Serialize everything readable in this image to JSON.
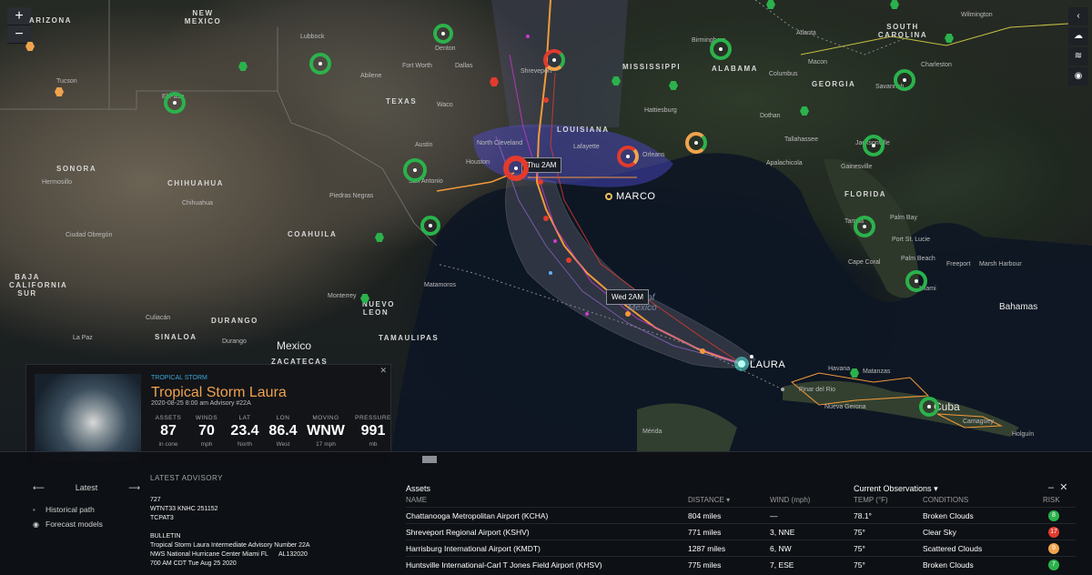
{
  "map": {
    "controls": {
      "zoom_in": "+",
      "zoom_out": "−"
    },
    "right_tools": [
      "chevron-left-icon",
      "cloud-icon",
      "layers-icon",
      "location-icon"
    ],
    "state_labels": [
      {
        "text": "ARIZONA"
      },
      {
        "text": "NEW MEXICO"
      },
      {
        "text": "TEXAS"
      },
      {
        "text": "LOUISIANA"
      },
      {
        "text": "MISSISSIPPI"
      },
      {
        "text": "ALABAMA"
      },
      {
        "text": "GEORGIA"
      },
      {
        "text": "SOUTH CAROLINA"
      },
      {
        "text": "FLORIDA"
      },
      {
        "text": "SONORA"
      },
      {
        "text": "CHIHUAHUA"
      },
      {
        "text": "COAHUILA"
      },
      {
        "text": "BAJA CALIFORNIA SUR"
      },
      {
        "text": "DURANGO"
      },
      {
        "text": "SINALOA"
      },
      {
        "text": "TAMAULIPAS"
      },
      {
        "text": "NUEVO LEON"
      },
      {
        "text": "ZACATECAS"
      }
    ],
    "city_labels": [
      "Lubbock",
      "Denton",
      "Fort Worth",
      "Dallas",
      "Abilene",
      "Waco",
      "Austin",
      "San Antonio",
      "Houston",
      "North Cleveland",
      "Lafayette",
      "Orleans",
      "Shreveport",
      "Birmingham",
      "Atlanta",
      "Macon",
      "Columbus",
      "Savannah",
      "Charleston",
      "Wilmington",
      "Hattiesburg",
      "Dothan",
      "Tallahassee",
      "Jacksonville",
      "Gainesville",
      "Apalachicola",
      "Tampa",
      "Palm Bay",
      "Port St. Lucie",
      "Palm Beach",
      "Freeport",
      "Marsh Harbour",
      "Cape Coral",
      "Miami",
      "Havana",
      "Matanzas",
      "Pinar del Rio",
      "Nueva Gerona",
      "Camagüey",
      "Holguín",
      "Mérida",
      "Hermosillo",
      "Ciudad Obregón",
      "Culiacán",
      "La Paz",
      "Durango",
      "Chihuahua",
      "Piedras Negras",
      "Monterrey",
      "Matamoros",
      "Tucson",
      "El Paso"
    ],
    "big_labels": {
      "mexico": "Mexico",
      "bahamas": "Bahamas",
      "cuba": "Cuba",
      "gulf": "Gulf of Mexico"
    },
    "tooltips": {
      "thu": "Thu 2AM",
      "wed": "Wed 2AM"
    },
    "storms": {
      "laura": "LAURA",
      "marco": "MARCO"
    },
    "colors": {
      "low_risk": "#2bb24c",
      "mid_risk": "#f0a34e",
      "high_risk": "#e23b2e",
      "forecast_track": "#f29a3a",
      "cone": "#5e5ae0"
    }
  },
  "storm_card": {
    "type": "TROPICAL STORM",
    "name": "Tropical Storm Laura",
    "date": "2020-08-25 8:00 am Advisory #22A",
    "stats": [
      {
        "label": "ASSETS",
        "value": "87",
        "unit": "in cone"
      },
      {
        "label": "WINDS",
        "value": "70",
        "unit": "mph"
      },
      {
        "label": "LAT",
        "value": "23.4",
        "unit": "North"
      },
      {
        "label": "LON",
        "value": "86.4",
        "unit": "West"
      },
      {
        "label": "MOVING",
        "value": "WNW",
        "unit": "17 mph"
      },
      {
        "label": "PRESSURE",
        "value": "991",
        "unit": "mb"
      }
    ]
  },
  "bottom": {
    "nav": {
      "current": "Latest",
      "items": [
        "Historical path",
        "Forecast models"
      ]
    },
    "advisory": {
      "title": "LATEST ADVISORY",
      "lines": [
        "727",
        "WTNT33 KNHC 251152",
        "TCPAT3",
        "",
        "BULLETIN",
        "Tropical Storm Laura Intermediate Advisory Number 22A",
        "NWS National Hurricane Center Miami FL      AL132020",
        "700 AM CDT Tue Aug 25 2020"
      ]
    },
    "assets": {
      "title": "Assets",
      "observations": "Current Observations",
      "headers": {
        "name": "NAME",
        "distance": "DISTANCE",
        "wind": "WIND (mph)",
        "temp": "TEMP (°F)",
        "conditions": "CONDITIONS",
        "risk": "RISK"
      },
      "rows": [
        {
          "name": "Chattanooga Metropolitan Airport (KCHA)",
          "distance": "804 miles",
          "wind": "—",
          "temp": "78.1°",
          "conditions": "Broken Clouds",
          "risk": "8",
          "risk_color": "#2bb24c"
        },
        {
          "name": "Shreveport Regional Airport (KSHV)",
          "distance": "771 miles",
          "wind": "3, NNE",
          "temp": "75°",
          "conditions": "Clear Sky",
          "risk": "17",
          "risk_color": "#e23b2e"
        },
        {
          "name": "Harrisburg International Airport (KMDT)",
          "distance": "1287 miles",
          "wind": "6, NW",
          "temp": "75°",
          "conditions": "Scattered Clouds",
          "risk": "9",
          "risk_color": "#f0a34e"
        },
        {
          "name": "Huntsville International-Carl T Jones Field Airport (KHSV)",
          "distance": "775 miles",
          "wind": "7, ESE",
          "temp": "75°",
          "conditions": "Broken Clouds",
          "risk": "7",
          "risk_color": "#2bb24c"
        }
      ]
    }
  }
}
